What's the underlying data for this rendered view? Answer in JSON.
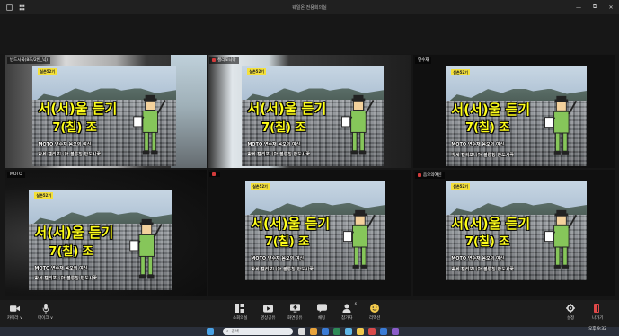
{
  "window": {
    "title": "웨일온 전용회의실",
    "grid_icon": "grid-icon",
    "home_icon": "home-icon",
    "minimize_glyph": "—",
    "maximize_glyph": "⧉",
    "close_glyph": "✕"
  },
  "slide": {
    "tag": "실촌52기",
    "line1": "서(서)울 듣기",
    "line2": "7(칠) 조",
    "line3": "MOTO  연수재  음오의 여신",
    "line4": "박세  캘리포니아  블롱칭  반도시꾹"
  },
  "participants": [
    {
      "name": "반드시꾹(8조/2반_닉)",
      "muted": false,
      "active": true
    },
    {
      "name": "캘리포니아",
      "muted": true,
      "active": false
    },
    {
      "name": "연수재",
      "muted": false,
      "active": false
    },
    {
      "name": "MOTO",
      "muted": false,
      "active": false
    },
    {
      "name": "",
      "muted": true,
      "active": false
    },
    {
      "name": "음오의여신",
      "muted": true,
      "active": false
    }
  ],
  "toolbar": {
    "left": [
      {
        "label": "카메라 ∨",
        "icon": "camera-icon"
      },
      {
        "label": "마이크 ∨",
        "icon": "microphone-icon"
      }
    ],
    "center": [
      {
        "label": "소회의실",
        "icon": "breakout-rooms-icon"
      },
      {
        "label": "영상공유",
        "icon": "video-share-icon"
      },
      {
        "label": "화면공유",
        "icon": "screen-share-icon"
      },
      {
        "label": "채팅",
        "icon": "chat-icon"
      },
      {
        "label": "참가자",
        "icon": "participants-icon",
        "badge": "6"
      },
      {
        "label": "리액션",
        "icon": "reaction-icon"
      }
    ],
    "right": [
      {
        "label": "설정",
        "icon": "settings-icon"
      },
      {
        "label": "나가기",
        "icon": "leave-icon"
      }
    ]
  },
  "taskbar": {
    "search_placeholder": "검색",
    "time": "오후 9:32",
    "date": "",
    "accent_colors": [
      "#2e8b57",
      "#3a7bd5",
      "#e8a33b",
      "#d94a4a",
      "#5fb8e8",
      "#f2c94c"
    ]
  },
  "colors": {
    "active_border": "#2f9e4a",
    "slide_text": "#ffff1a",
    "leave_red": "#e04848"
  }
}
